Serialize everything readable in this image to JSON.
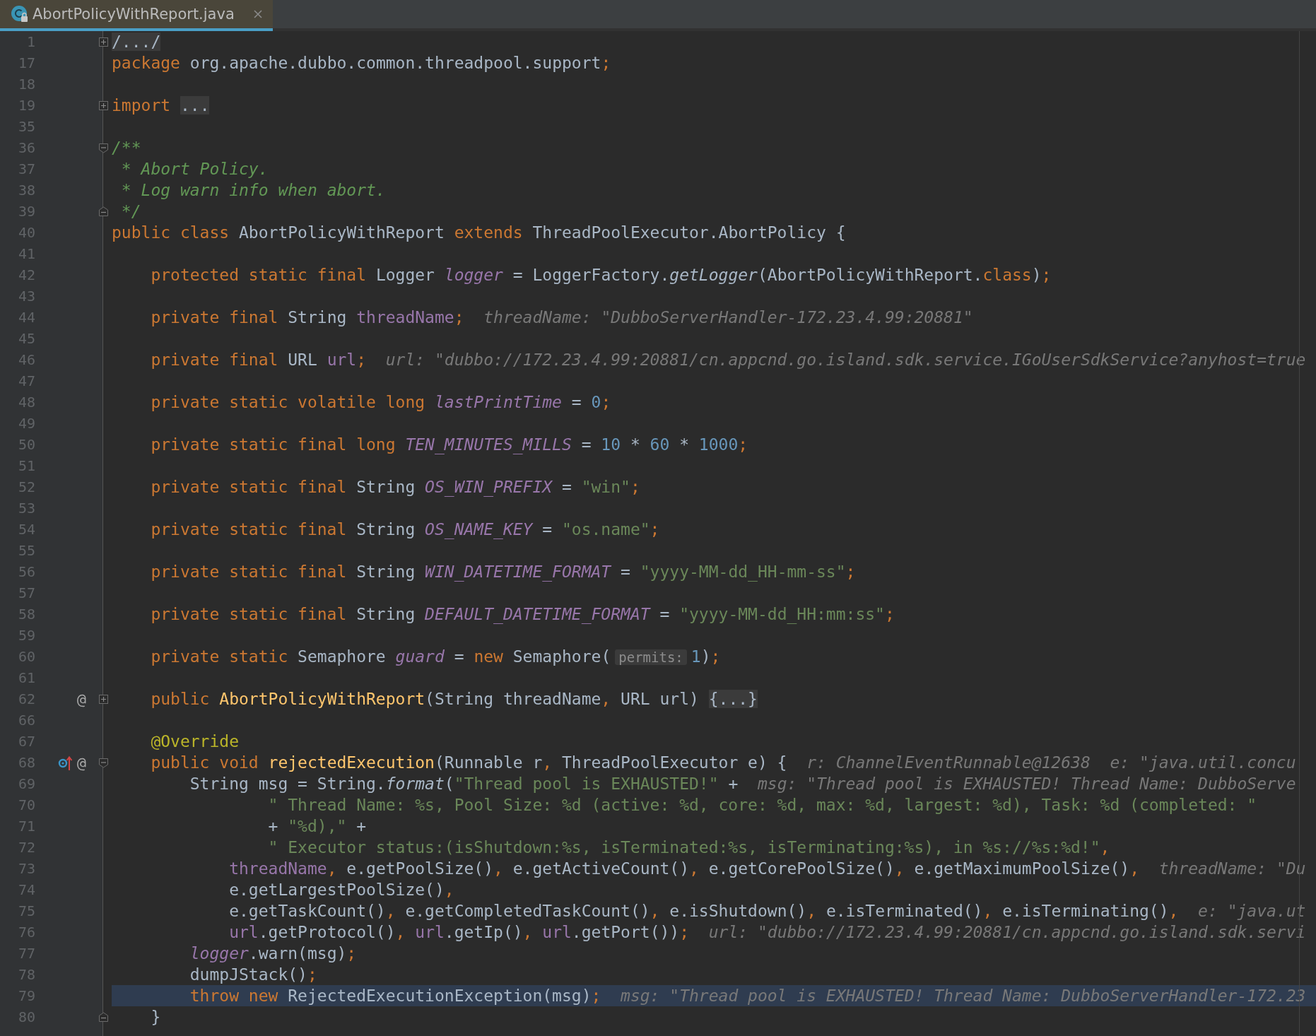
{
  "tab": {
    "title": "AbortPolicyWithReport.java",
    "selected": true
  },
  "lines": [
    {
      "number": "1",
      "kind": "top",
      "fold": {
        "kind": "expand"
      },
      "current": false,
      "tokens": [
        {
          "kind": "folded",
          "text": "/.../"
        }
      ]
    },
    {
      "number": "17",
      "kind": "top",
      "current": false,
      "tokens": [
        {
          "kind": "keyword",
          "text": "package "
        },
        {
          "kind": "plain",
          "text": "org.apache.dubbo.common.threadpool.support"
        },
        {
          "kind": "keyword",
          "text": ";"
        }
      ]
    },
    {
      "number": "18",
      "kind": "top",
      "current": false
    },
    {
      "number": "19",
      "kind": "top",
      "fold": {
        "kind": "expand"
      },
      "current": false,
      "tokens": [
        {
          "kind": "keyword",
          "text": "import "
        },
        {
          "kind": "folded",
          "text": "..."
        }
      ]
    },
    {
      "number": "35",
      "kind": "top",
      "current": false
    },
    {
      "number": "36",
      "kind": "top",
      "fold": {
        "kind": "collapse-start"
      },
      "current": false,
      "tokens": [
        {
          "kind": "doc",
          "text": "/**"
        }
      ]
    },
    {
      "number": "37",
      "kind": "top",
      "current": false,
      "tokens": [
        {
          "kind": "doc",
          "text": " * Abort Policy."
        }
      ]
    },
    {
      "number": "38",
      "kind": "top",
      "current": false,
      "tokens": [
        {
          "kind": "doc",
          "text": " * Log warn info when abort."
        }
      ]
    },
    {
      "number": "39",
      "kind": "top",
      "fold": {
        "kind": "collapse-end"
      },
      "current": false,
      "tokens": [
        {
          "kind": "doc",
          "text": " */"
        }
      ]
    },
    {
      "number": "40",
      "kind": "top",
      "current": false,
      "tokens": [
        {
          "kind": "keyword",
          "text": "public class "
        },
        {
          "kind": "plain",
          "text": "AbortPolicyWithReport "
        },
        {
          "kind": "keyword",
          "text": "extends "
        },
        {
          "kind": "plain",
          "text": "ThreadPoolExecutor.AbortPolicy {"
        }
      ]
    },
    {
      "number": "41",
      "kind": "top",
      "current": false
    },
    {
      "number": "42",
      "kind": "member",
      "current": false,
      "tokens": [
        {
          "kind": "keyword",
          "text": "protected static final "
        },
        {
          "kind": "plain",
          "text": "Logger "
        },
        {
          "kind": "static-field",
          "text": "logger"
        },
        {
          "kind": "plain",
          "text": " = LoggerFactory."
        },
        {
          "kind": "static-call",
          "text": "getLogger"
        },
        {
          "kind": "plain",
          "text": "(AbortPolicyWithReport."
        },
        {
          "kind": "keyword",
          "text": "class"
        },
        {
          "kind": "plain",
          "text": ")"
        },
        {
          "kind": "keyword",
          "text": ";"
        }
      ]
    },
    {
      "number": "43",
      "kind": "top",
      "current": false
    },
    {
      "number": "44",
      "kind": "member",
      "current": false,
      "tokens": [
        {
          "kind": "keyword",
          "text": "private final "
        },
        {
          "kind": "plain",
          "text": "String "
        },
        {
          "kind": "field",
          "text": "threadName"
        },
        {
          "kind": "keyword",
          "text": ";"
        }
      ],
      "hints": [
        "threadName: \"DubboServerHandler-172.23.4.99:20881\""
      ]
    },
    {
      "number": "45",
      "kind": "top",
      "current": false
    },
    {
      "number": "46",
      "kind": "member",
      "current": false,
      "tokens": [
        {
          "kind": "keyword",
          "text": "private final "
        },
        {
          "kind": "plain",
          "text": "URL "
        },
        {
          "kind": "field",
          "text": "url"
        },
        {
          "kind": "keyword",
          "text": ";"
        }
      ],
      "hints": [
        "url: \"dubbo://172.23.4.99:20881/cn.appcnd.go.island.sdk.service.IGoUserSdkService?anyhost=true"
      ]
    },
    {
      "number": "47",
      "kind": "top",
      "current": false
    },
    {
      "number": "48",
      "kind": "member",
      "current": false,
      "tokens": [
        {
          "kind": "keyword",
          "text": "private static volatile long "
        },
        {
          "kind": "static-field",
          "text": "lastPrintTime"
        },
        {
          "kind": "plain",
          "text": " = "
        },
        {
          "kind": "number",
          "text": "0"
        },
        {
          "kind": "keyword",
          "text": ";"
        }
      ]
    },
    {
      "number": "49",
      "kind": "top",
      "current": false
    },
    {
      "number": "50",
      "kind": "member",
      "current": false,
      "tokens": [
        {
          "kind": "keyword",
          "text": "private static final long "
        },
        {
          "kind": "static-field",
          "text": "TEN_MINUTES_MILLS"
        },
        {
          "kind": "plain",
          "text": " = "
        },
        {
          "kind": "number",
          "text": "10"
        },
        {
          "kind": "plain",
          "text": " * "
        },
        {
          "kind": "number",
          "text": "60"
        },
        {
          "kind": "plain",
          "text": " * "
        },
        {
          "kind": "number",
          "text": "1000"
        },
        {
          "kind": "keyword",
          "text": ";"
        }
      ]
    },
    {
      "number": "51",
      "kind": "top",
      "current": false
    },
    {
      "number": "52",
      "kind": "member",
      "current": false,
      "tokens": [
        {
          "kind": "keyword",
          "text": "private static final "
        },
        {
          "kind": "plain",
          "text": "String "
        },
        {
          "kind": "static-field",
          "text": "OS_WIN_PREFIX"
        },
        {
          "kind": "plain",
          "text": " = "
        },
        {
          "kind": "string",
          "text": "\"win\""
        },
        {
          "kind": "keyword",
          "text": ";"
        }
      ]
    },
    {
      "number": "53",
      "kind": "top",
      "current": false
    },
    {
      "number": "54",
      "kind": "member",
      "current": false,
      "tokens": [
        {
          "kind": "keyword",
          "text": "private static final "
        },
        {
          "kind": "plain",
          "text": "String "
        },
        {
          "kind": "static-field",
          "text": "OS_NAME_KEY"
        },
        {
          "kind": "plain",
          "text": " = "
        },
        {
          "kind": "string",
          "text": "\"os.name\""
        },
        {
          "kind": "keyword",
          "text": ";"
        }
      ]
    },
    {
      "number": "55",
      "kind": "top",
      "current": false
    },
    {
      "number": "56",
      "kind": "member",
      "current": false,
      "tokens": [
        {
          "kind": "keyword",
          "text": "private static final "
        },
        {
          "kind": "plain",
          "text": "String "
        },
        {
          "kind": "static-field",
          "text": "WIN_DATETIME_FORMAT"
        },
        {
          "kind": "plain",
          "text": " = "
        },
        {
          "kind": "string",
          "text": "\"yyyy-MM-dd_HH-mm-ss\""
        },
        {
          "kind": "keyword",
          "text": ";"
        }
      ]
    },
    {
      "number": "57",
      "kind": "top",
      "current": false
    },
    {
      "number": "58",
      "kind": "member",
      "current": false,
      "tokens": [
        {
          "kind": "keyword",
          "text": "private static final "
        },
        {
          "kind": "plain",
          "text": "String "
        },
        {
          "kind": "static-field",
          "text": "DEFAULT_DATETIME_FORMAT"
        },
        {
          "kind": "plain",
          "text": " = "
        },
        {
          "kind": "string",
          "text": "\"yyyy-MM-dd_HH:mm:ss\""
        },
        {
          "kind": "keyword",
          "text": ";"
        }
      ]
    },
    {
      "number": "59",
      "kind": "top",
      "current": false
    },
    {
      "number": "60",
      "kind": "member",
      "current": false,
      "tokens": [
        {
          "kind": "keyword",
          "text": "private static "
        },
        {
          "kind": "plain",
          "text": "Semaphore "
        },
        {
          "kind": "static-field",
          "text": "guard"
        },
        {
          "kind": "plain",
          "text": " = "
        },
        {
          "kind": "keyword",
          "text": "new "
        },
        {
          "kind": "plain",
          "text": "Semaphore("
        },
        {
          "kind": "param-hint",
          "text": "permits:"
        },
        {
          "kind": "number",
          "text": "1"
        },
        {
          "kind": "plain",
          "text": ")"
        },
        {
          "kind": "keyword",
          "text": ";"
        }
      ]
    },
    {
      "number": "61",
      "kind": "top",
      "current": false
    },
    {
      "number": "62",
      "kind": "member",
      "fold": {
        "kind": "expand"
      },
      "current": false,
      "gutter": [
        {
          "kind": "text",
          "text": "@"
        }
      ],
      "tokens": [
        {
          "kind": "keyword",
          "text": "public "
        },
        {
          "kind": "method",
          "text": "AbortPolicyWithReport"
        },
        {
          "kind": "plain",
          "text": "(String threadName"
        },
        {
          "kind": "keyword",
          "text": ", "
        },
        {
          "kind": "plain",
          "text": "URL url) "
        },
        {
          "kind": "folded",
          "text": "{...}"
        }
      ]
    },
    {
      "number": "66",
      "kind": "top",
      "current": false
    },
    {
      "number": "67",
      "kind": "member",
      "current": false,
      "tokens": [
        {
          "kind": "annotation",
          "text": "@Override"
        }
      ]
    },
    {
      "number": "68",
      "kind": "member",
      "fold": {
        "kind": "collapse-start"
      },
      "current": false,
      "gutter": [
        {
          "kind": "override-arrow"
        },
        {
          "kind": "text",
          "text": "@"
        }
      ],
      "tokens": [
        {
          "kind": "keyword",
          "text": "public void "
        },
        {
          "kind": "method",
          "text": "rejectedExecution"
        },
        {
          "kind": "plain",
          "text": "(Runnable r"
        },
        {
          "kind": "keyword",
          "text": ", "
        },
        {
          "kind": "plain",
          "text": "ThreadPoolExecutor e) {"
        }
      ],
      "hints": [
        "r: ChannelEventRunnable@12638",
        "e: \"java.util.concu"
      ]
    },
    {
      "number": "69",
      "kind": "statement",
      "current": false,
      "tokens": [
        {
          "kind": "plain",
          "text": "String msg = String."
        },
        {
          "kind": "static-call",
          "text": "format"
        },
        {
          "kind": "plain",
          "text": "("
        },
        {
          "kind": "string",
          "text": "\"Thread pool is EXHAUSTED!\""
        },
        {
          "kind": "plain",
          "text": " +"
        }
      ],
      "hints": [
        "msg: \"Thread pool is EXHAUSTED! Thread Name: DubboServe"
      ]
    },
    {
      "number": "70",
      "kind": "continuation",
      "current": false,
      "tokens": [
        {
          "kind": "string",
          "text": "\" Thread Name: %s, Pool Size: %d (active: %d, core: %d, max: %d, largest: %d), Task: %d (completed: \""
        }
      ]
    },
    {
      "number": "71",
      "kind": "continuation",
      "current": false,
      "tokens": [
        {
          "kind": "plain",
          "text": "+ "
        },
        {
          "kind": "string",
          "text": "\"%d),\""
        },
        {
          "kind": "plain",
          "text": " +"
        }
      ]
    },
    {
      "number": "72",
      "kind": "continuation",
      "current": false,
      "tokens": [
        {
          "kind": "string",
          "text": "\" Executor status:(isShutdown:%s, isTerminated:%s, isTerminating:%s), in %s://%s:%d!\""
        },
        {
          "kind": "keyword",
          "text": ","
        }
      ]
    },
    {
      "number": "73",
      "kind": "argument",
      "current": false,
      "tokens": [
        {
          "kind": "field",
          "text": "threadName"
        },
        {
          "kind": "keyword",
          "text": ", "
        },
        {
          "kind": "plain",
          "text": "e.getPoolSize()"
        },
        {
          "kind": "keyword",
          "text": ", "
        },
        {
          "kind": "plain",
          "text": "e.getActiveCount()"
        },
        {
          "kind": "keyword",
          "text": ", "
        },
        {
          "kind": "plain",
          "text": "e.getCorePoolSize()"
        },
        {
          "kind": "keyword",
          "text": ", "
        },
        {
          "kind": "plain",
          "text": "e.getMaximumPoolSize()"
        },
        {
          "kind": "keyword",
          "text": ","
        }
      ],
      "hints": [
        "threadName: \"Du"
      ]
    },
    {
      "number": "74",
      "kind": "argument",
      "current": false,
      "tokens": [
        {
          "kind": "plain",
          "text": "e.getLargestPoolSize()"
        },
        {
          "kind": "keyword",
          "text": ","
        }
      ]
    },
    {
      "number": "75",
      "kind": "argument",
      "current": false,
      "tokens": [
        {
          "kind": "plain",
          "text": "e.getTaskCount()"
        },
        {
          "kind": "keyword",
          "text": ", "
        },
        {
          "kind": "plain",
          "text": "e.getCompletedTaskCount()"
        },
        {
          "kind": "keyword",
          "text": ", "
        },
        {
          "kind": "plain",
          "text": "e.isShutdown()"
        },
        {
          "kind": "keyword",
          "text": ", "
        },
        {
          "kind": "plain",
          "text": "e.isTerminated()"
        },
        {
          "kind": "keyword",
          "text": ", "
        },
        {
          "kind": "plain",
          "text": "e.isTerminating()"
        },
        {
          "kind": "keyword",
          "text": ","
        }
      ],
      "hints": [
        "e: \"java.ut"
      ]
    },
    {
      "number": "76",
      "kind": "argument",
      "current": false,
      "tokens": [
        {
          "kind": "field",
          "text": "url"
        },
        {
          "kind": "plain",
          "text": ".getProtocol()"
        },
        {
          "kind": "keyword",
          "text": ", "
        },
        {
          "kind": "field",
          "text": "url"
        },
        {
          "kind": "plain",
          "text": ".getIp()"
        },
        {
          "kind": "keyword",
          "text": ", "
        },
        {
          "kind": "field",
          "text": "url"
        },
        {
          "kind": "plain",
          "text": ".getPort())"
        },
        {
          "kind": "keyword",
          "text": ";"
        }
      ],
      "hints": [
        "url: \"dubbo://172.23.4.99:20881/cn.appcnd.go.island.sdk.servi"
      ]
    },
    {
      "number": "77",
      "kind": "statement",
      "current": false,
      "tokens": [
        {
          "kind": "static-field",
          "text": "logger"
        },
        {
          "kind": "plain",
          "text": ".warn(msg)"
        },
        {
          "kind": "keyword",
          "text": ";"
        }
      ]
    },
    {
      "number": "78",
      "kind": "statement",
      "current": false,
      "tokens": [
        {
          "kind": "plain",
          "text": "dumpJStack()"
        },
        {
          "kind": "keyword",
          "text": ";"
        }
      ]
    },
    {
      "number": "79",
      "kind": "statement",
      "current": true,
      "tokens": [
        {
          "kind": "keyword",
          "text": "throw new "
        },
        {
          "kind": "plain",
          "text": "RejectedExecutionException(msg)"
        },
        {
          "kind": "keyword",
          "text": ";"
        }
      ],
      "hints": [
        "msg: \"Thread pool is EXHAUSTED! Thread Name: DubboServerHandler-172.23"
      ]
    },
    {
      "number": "80",
      "kind": "member",
      "fold": {
        "kind": "collapse-end"
      },
      "current": false,
      "tokens": [
        {
          "kind": "plain",
          "text": "}"
        }
      ]
    }
  ]
}
